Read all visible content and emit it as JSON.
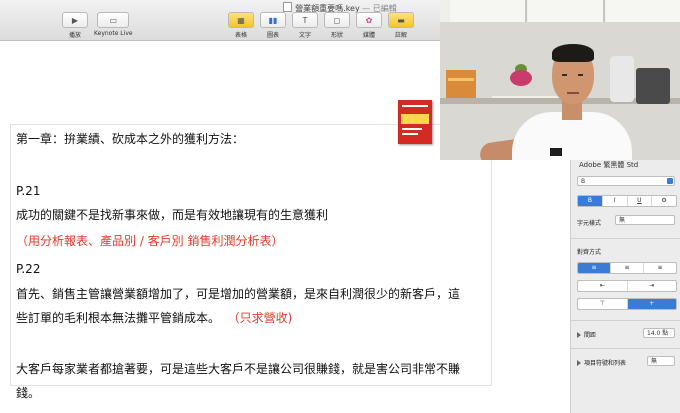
{
  "window": {
    "title": "營業額重要嗎.key",
    "edited_status": "— 已編輯"
  },
  "toolbar": {
    "left": [
      {
        "label": "播放",
        "icon": "play-icon"
      },
      {
        "label": "Keynote Live",
        "icon": "keynote-live-icon"
      }
    ],
    "center": [
      {
        "label": "表格",
        "icon": "table-icon"
      },
      {
        "label": "圖表",
        "icon": "chart-icon"
      },
      {
        "label": "文字",
        "icon": "text-icon"
      },
      {
        "label": "形狀",
        "icon": "shape-icon"
      },
      {
        "label": "媒體",
        "icon": "media-icon"
      },
      {
        "label": "註解",
        "icon": "comment-icon"
      }
    ]
  },
  "slide": {
    "lines": [
      "第一章：拚業績、砍成本之外的獲利方法：",
      "P.21",
      "成功的關鍵不是找新事來做，而是有效地讓現有的生意獲利",
      "（用分析報表、產品別 / 客戶別 銷售利潤分析表）",
      "P.22",
      "首先、銷售主管讓營業額增加了，可是增加的營業額，是來自利潤很少的新客戶，這",
      "些訂單的毛利根本無法攤平管銷成本。",
      "（只求營收)",
      "大客戶每家業者都搶著要，可是這些大客戶不是讓公司很賺錢，就是害公司非常不賺",
      "錢。"
    ]
  },
  "inspector": {
    "font_family": "Adobe 繁黑體 Std",
    "font_style": "B",
    "style_buttons": [
      "B",
      "I",
      "U",
      "⚙"
    ],
    "char_style_label": "字元樣式",
    "char_style_value": "無",
    "alignment_label": "對齊方式",
    "align_buttons": [
      "≡",
      "≡",
      "≡"
    ],
    "indent_buttons": [
      "⇤",
      "⇥"
    ],
    "valign_buttons": [
      "⊤",
      "+"
    ],
    "spacing_label": "間距",
    "spacing_value": "14.0 點",
    "bullets_label": "項目符號和列表",
    "bullets_value": "無"
  },
  "colors": {
    "accent": "#3a7bd5",
    "red_text": "#e0392b"
  }
}
